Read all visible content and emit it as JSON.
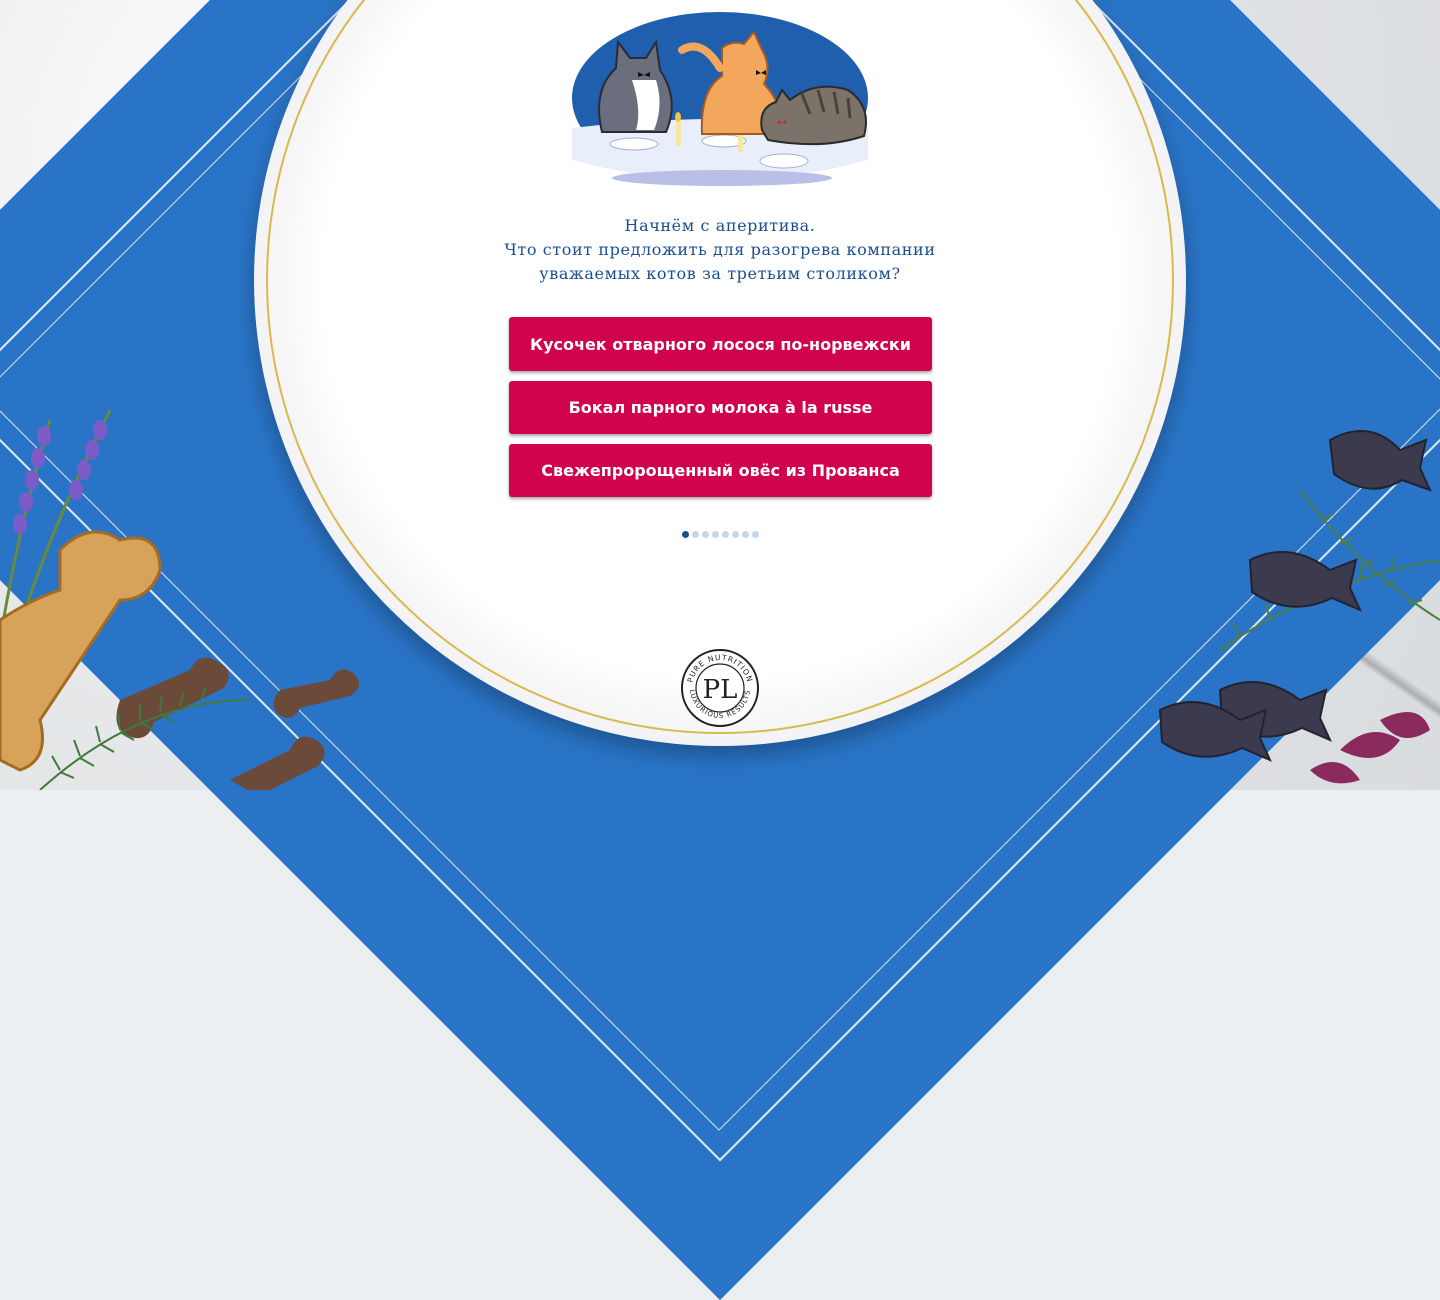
{
  "quiz": {
    "question_lines": [
      "Начнём с аперитива.",
      "Что стоит предложить для разогрева компании",
      "уважаемых котов за третьим столиком?"
    ],
    "answers": [
      "Кусочек отварного лосося по-норвежски",
      "Бокал парного молока à la russe",
      "Свежепророщенный овёс из Прованса"
    ],
    "pagination": {
      "total": 8,
      "current": 1
    }
  },
  "logo": {
    "monogram": "PL",
    "ring_top": "PURE NUTRITION",
    "ring_bottom": "LUXURIOUS RESULTS"
  },
  "colors": {
    "napkin": "#2a74c7",
    "button": "#d1034f",
    "question_text": "#1a4f8f",
    "plate_rim": "#d9b94a"
  },
  "icons": [
    "cats-dinner-illustration",
    "lavender-icon",
    "bone-icon",
    "fish-icon",
    "rosemary-icon",
    "basil-icon"
  ]
}
